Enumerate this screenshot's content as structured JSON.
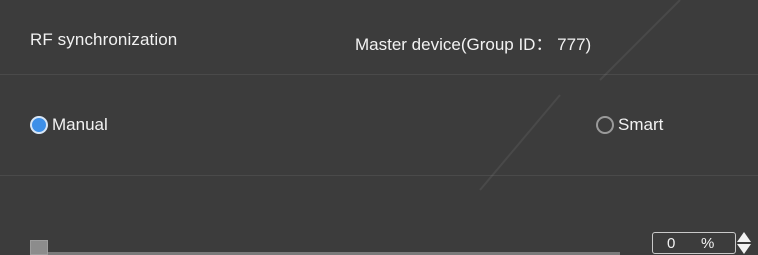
{
  "header": {
    "title": "RF synchronization",
    "master_status": "Master device(Group ID： 777)"
  },
  "mode": {
    "options": [
      {
        "label": "Manual",
        "checked": true
      },
      {
        "label": "Smart",
        "checked": false
      }
    ]
  },
  "level": {
    "value": "0",
    "unit": "%",
    "fraction": 0.0
  },
  "colors": {
    "panel_bg": "#3c3c3c",
    "accent": "#3d8fe8",
    "text": "#f2f2f2"
  },
  "icons": {
    "spin_up": "triangle-up-icon",
    "spin_down": "triangle-down-icon"
  }
}
